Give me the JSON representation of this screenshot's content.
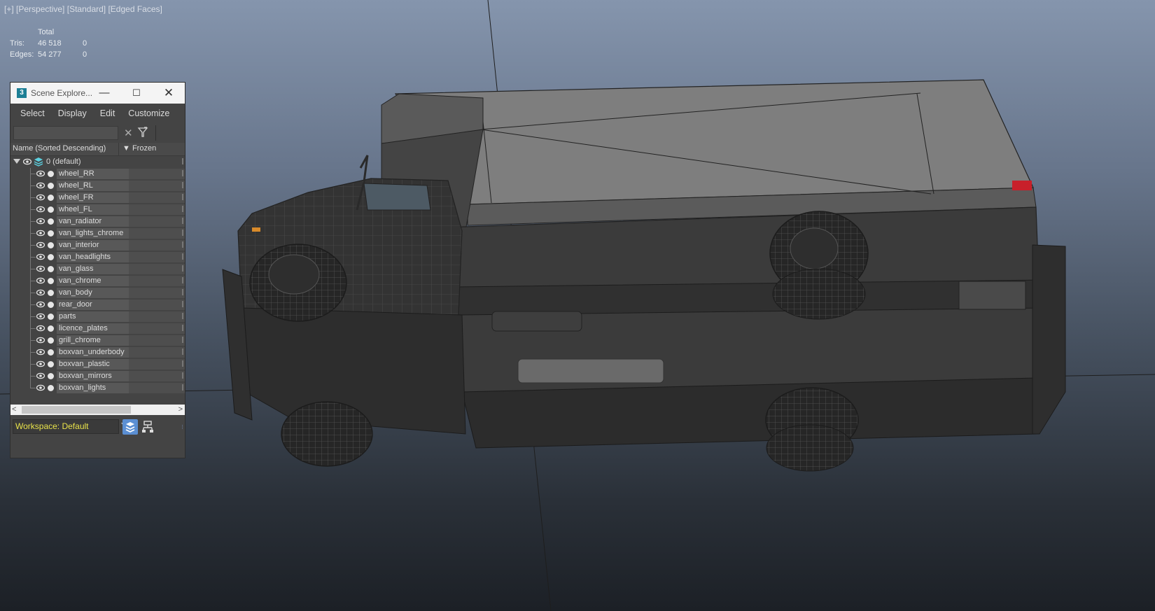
{
  "viewport": {
    "label_items": [
      "[+]",
      "[Perspective]",
      "[Standard]",
      "[Edged Faces]"
    ]
  },
  "stats": {
    "header": "Total",
    "rows": [
      {
        "label": "Tris:",
        "total": "46 518",
        "selected": "0"
      },
      {
        "label": "Edges:",
        "total": "54 277",
        "selected": "0"
      }
    ]
  },
  "scene_explorer": {
    "app_icon": "3",
    "title": "Scene Explore...",
    "window_buttons": {
      "minimize": "—",
      "maximize": "☐",
      "close": "✕"
    },
    "menu": [
      "Select",
      "Display",
      "Edit",
      "Customize"
    ],
    "search": {
      "value": "",
      "placeholder": ""
    },
    "clear_icon": "✕",
    "columns": {
      "name": "Name (Sorted Descending)",
      "frozen": "Frozen"
    },
    "root_layer": "0 (default)",
    "objects": [
      "wheel_RR",
      "wheel_RL",
      "wheel_FR",
      "wheel_FL",
      "van_radiator",
      "van_lights_chrome",
      "van_interior",
      "van_headlights",
      "van_glass",
      "van_chrome",
      "van_body",
      "rear_door",
      "parts",
      "licence_plates",
      "grill_chrome",
      "boxvan_underbody",
      "boxvan_plastic",
      "boxvan_mirrors",
      "boxvan_lights"
    ],
    "scroll_left": "<",
    "scroll_right": ">",
    "workspace": "Workspace: Default"
  },
  "colors": {
    "panel_bg": "#444444",
    "workspace_text": "#e8e24a",
    "accent_button": "#5b8fd3",
    "tail_light": "#c8202a"
  }
}
